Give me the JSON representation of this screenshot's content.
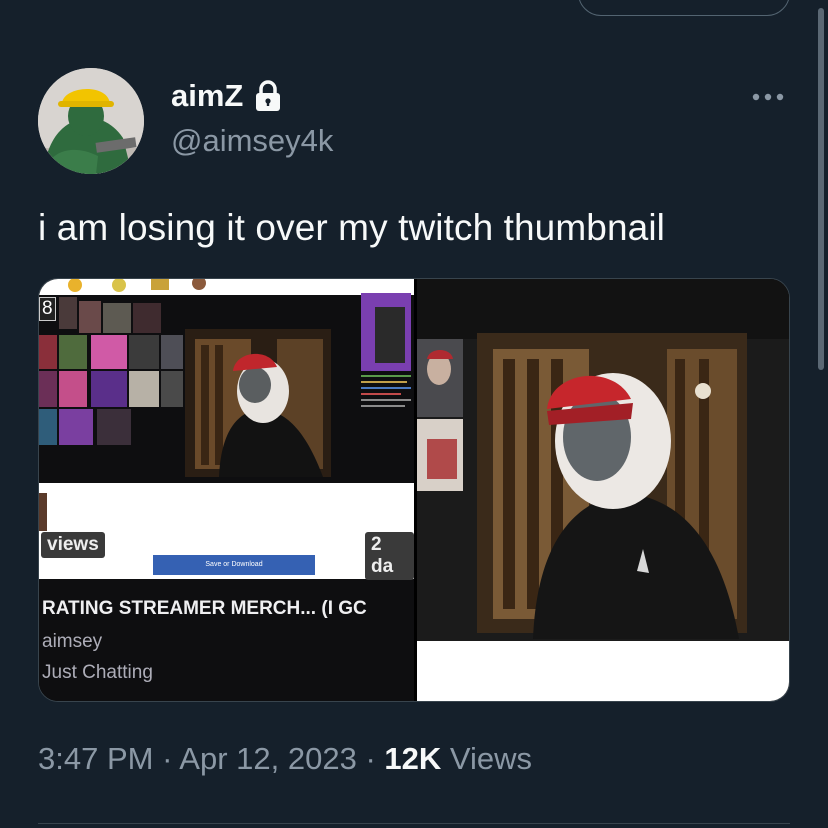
{
  "tweet": {
    "author_name": "aimZ",
    "handle": "@aimsey4k",
    "text": "i am losing it over my twitch thumbnail",
    "time": "3:47 PM",
    "separator": " · ",
    "date": "Apr 12, 2023",
    "view_count": "12K",
    "views_label": " Views"
  },
  "media": {
    "left_image": {
      "viewer_count": "8",
      "views_badge": "views",
      "days_badge": "2 da",
      "save_button": "Save or Download",
      "stream_title": "RATING STREAMER MERCH... (I GC",
      "streamer": "aimsey",
      "category": "Just Chatting"
    }
  },
  "colors": {
    "background": "#15202b",
    "primary_text": "#f7f9f9",
    "secondary_text": "#8b98a5",
    "border": "#38444d"
  },
  "icons": {
    "lock": "lock-icon",
    "more": "more-icon"
  }
}
